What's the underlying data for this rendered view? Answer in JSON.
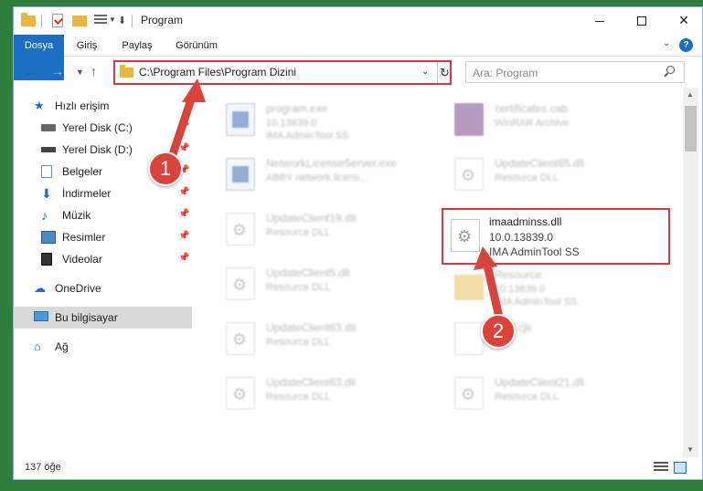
{
  "window": {
    "title": "Program",
    "controls": {
      "minimize": "minimize",
      "maximize": "maximize",
      "close": "✕"
    }
  },
  "ribbon": {
    "tabs": [
      "Dosya",
      "Giriş",
      "Paylaş",
      "Görünüm"
    ],
    "help": "?"
  },
  "navigation": {
    "address": "C:\\Program Files\\Program Dizini",
    "search_placeholder": "Ara: Program"
  },
  "sidebar": {
    "items": [
      {
        "label": "Hızlı erişim",
        "icon": "star-icon"
      },
      {
        "label": "Yerel Disk (C:)",
        "icon": "drive-icon"
      },
      {
        "label": "Yerel Disk (D:)",
        "icon": "drive-icon"
      },
      {
        "label": "Belgeler",
        "icon": "documents-icon"
      },
      {
        "label": "İndirmeler",
        "icon": "downloads-icon"
      },
      {
        "label": "Müzik",
        "icon": "music-icon"
      },
      {
        "label": "Resimler",
        "icon": "pictures-icon"
      },
      {
        "label": "Videolar",
        "icon": "videos-icon"
      },
      {
        "label": "OneDrive",
        "icon": "onedrive-icon"
      },
      {
        "label": "Bu bilgisayar",
        "icon": "computer-icon",
        "selected": true
      },
      {
        "label": "Ağ",
        "icon": "network-icon"
      }
    ]
  },
  "files": [
    {
      "name": "program.exe",
      "meta1": "10.13839.0",
      "meta2": "IMA AdminTool SS",
      "icon": "exe-icon"
    },
    {
      "name": "certificates.cab",
      "meta1": "WinRAR Archive",
      "meta2": "",
      "icon": "archive-icon"
    },
    {
      "name": "NetworkLicenseServer.exe",
      "meta1": "ABBY network licens...",
      "meta2": "",
      "icon": "exe-icon"
    },
    {
      "name": "UpdateClient65.dll",
      "meta1": "Resource DLL",
      "meta2": "",
      "icon": "dll-icon"
    },
    {
      "name": "UpdateClient19.dll",
      "meta1": "Resource DLL",
      "meta2": "",
      "icon": "dll-icon"
    },
    {
      "name": "imaadminss.dll",
      "meta1": "10.0.13839.0",
      "meta2": "IMA AdminTool SS",
      "icon": "dll-icon"
    },
    {
      "name": "UpdateClient5.dll",
      "meta1": "Resource DLL",
      "meta2": "",
      "icon": "dll-icon"
    },
    {
      "name": "Resource",
      "meta1": "10.13839.0",
      "meta2": "IMA AdminTool SS",
      "icon": "folder-icon"
    },
    {
      "name": "UpdateClient63.dll",
      "meta1": "Resource DLL",
      "meta2": "",
      "icon": "dll-icon"
    },
    {
      "name": "html.cjk",
      "meta1": "",
      "meta2": "",
      "icon": "file-icon"
    },
    {
      "name": "UpdateClient63.dll",
      "meta1": "Resource DLL",
      "meta2": "",
      "icon": "dll-icon"
    },
    {
      "name": "UpdateClient21.dll",
      "meta1": "Resource DLL",
      "meta2": "",
      "icon": "dll-icon"
    }
  ],
  "status": {
    "count": "137 öğe"
  },
  "annotations": {
    "step1": "1",
    "step2": "2",
    "color": "#d9433a"
  }
}
